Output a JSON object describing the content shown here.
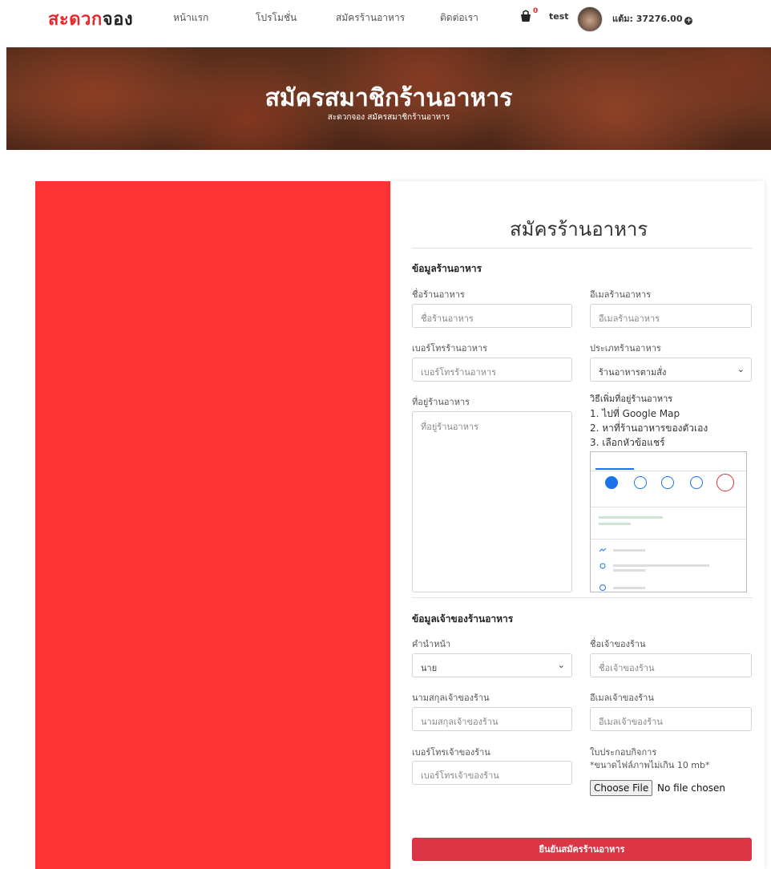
{
  "navbar": {
    "brand_part1": "สะดวก",
    "brand_part2": "จอง",
    "links": [
      "หน้าแรก",
      "โปรโมชั่น",
      "สมัครร้านอาหาร",
      "ติดต่อเรา"
    ],
    "cart_count": "0",
    "username": "test",
    "credit_label": "แต้ม: 37276.00",
    "credit_icon": "plus-circle-icon"
  },
  "hero": {
    "title": "สมัครสมาชิกร้านอาหาร",
    "breadcrumb": "สะดวกจอง สมัครสมาชิกร้านอาหาร"
  },
  "form": {
    "title": "สมัครร้านอาหาร",
    "restaurant_section": {
      "title": "ข้อมูลร้านอาหาร",
      "name_label": "ชื่อร้านอาหาร",
      "name_placeholder": "ชื่อร้านอาหาร",
      "email_label": "อีเมลร้านอาหาร",
      "email_placeholder": "อีเมลร้านอาหาร",
      "phone_label": "เบอร์โทรร้านอาหาร",
      "phone_placeholder": "เบอร์โทรร้านอาหาร",
      "type_label": "ประเภทร้านอาหาร",
      "type_value": "ร้านอาหารตามสั่ง",
      "address_label": "ที่อยู่ร้านอาหาร",
      "address_placeholder": "ที่อยู่ร้านอาหาร",
      "howto_title": "วิธีเพิ่มที่อยู่ร้านอาหาร",
      "howto_steps": [
        "1. ไปที่ Google Map",
        "2. หาที่ร้านอาหารของตัวเอง",
        "3. เลือกหัวข้อแชร์"
      ]
    },
    "owner_section": {
      "title": "ข้อมูลเจ้าของร้านอาหาร",
      "prefix_label": "คำนำหน้า",
      "prefix_value": "นาย",
      "firstname_label": "ชื่อเจ้าของร้าน",
      "firstname_placeholder": "ชื่อเจ้าของร้าน",
      "lastname_label": "นามสกุลเจ้าของร้าน",
      "lastname_placeholder": "นามสกุลเจ้าของร้าน",
      "email_label": "อีเมลเจ้าของร้าน",
      "email_placeholder": "อีเมลเจ้าของร้าน",
      "phone_label": "เบอร์โทรเจ้าของร้าน",
      "phone_placeholder": "เบอร์โทรเจ้าของร้าน",
      "license_label": "ใบประกอบกิจการ",
      "license_note": "*ขนาดไฟล์ภาพไม่เกิน 10 mb*",
      "file_button": "Choose File",
      "file_status": "No file chosen"
    },
    "submit_label": "ยืนยันสมัครร้านอาหาร"
  },
  "colors": {
    "brand_red": "#e8262d",
    "left_panel": "#ff3333",
    "submit": "#dc3545"
  }
}
